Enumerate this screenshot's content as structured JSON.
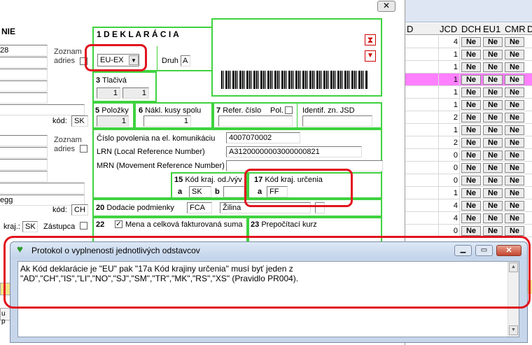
{
  "left_form": {
    "heading": "NIE",
    "sender_value": "28",
    "zoznam_adries_top": "Zoznam adries",
    "zoznam_adries_mid": "Zoznam adries",
    "kod_label_1": "kód:",
    "kod_value_1": "SK",
    "name_value": "egg",
    "kod_label_2": "kód:",
    "kod_value_2": "CH",
    "kraj_label": "kraj.:",
    "kraj_value": "SK",
    "zastupca_label": "Zástupca"
  },
  "declaration": {
    "title": "1  D E K L A R Á C I A",
    "type_value": "EU-EX",
    "druh_label": "Druh",
    "druh_value": "A",
    "tlaciva_num": "3",
    "tlaciva_label": "Tlačivá",
    "tlaciva_value1": "1",
    "tlaciva_value2": "1",
    "polozky_num": "5",
    "polozky_label": "Položky",
    "polozky_value": "1",
    "kusy_num": "6",
    "kusy_label": "Nákl. kusy spolu",
    "kusy_value": "1",
    "refer_num": "7",
    "refer_label": "Refer. číslo",
    "pol_label": "Pol.",
    "identif_label": "Identif. zn. JSD",
    "povolenie_label": "Číslo povolenia na el. komunikáciu",
    "povolenie_value": "4007070002",
    "lrn_label": "LRN (Local Reference Number)",
    "lrn_value": "A31200000003000000821",
    "mrn_label": "MRN (Movement Reference Number)",
    "mrn_value": "",
    "odosl_num": "15",
    "odosl_label": "Kód kraj. od./výv",
    "odosl_a": "a",
    "odosl_value": "SK",
    "odosl_b": "b",
    "urcenia_num": "17",
    "urcenia_label": "Kód kraj. určenia",
    "urcenia_a": "a",
    "urcenia_value": "FF",
    "dodacie_num": "20",
    "dodacie_label": "Dodacie podmienky",
    "dodacie_value": "FCA",
    "dodacie_place": "Žilina",
    "mena_num": "22",
    "mena_label": "Mena a celková fakturovaná suma",
    "kurz_num": "23",
    "kurz_label": "Prepočítací kurz"
  },
  "grid": {
    "headers": [
      "D",
      "JCD",
      "DCH",
      "EU1",
      "CMR",
      "D"
    ],
    "button_label": "Ne",
    "jcd_values": [
      "4",
      "1",
      "1",
      "1",
      "1",
      "1",
      "2",
      "1",
      "2",
      "0",
      "0",
      "0",
      "1",
      "4",
      "4",
      "0"
    ],
    "highlight_color": "#ff80ff"
  },
  "dialog": {
    "title": "Protokol o vyplnenosti jednotlivých odstavcov",
    "message": "Ak Kód deklarácie je \"EU\" pak \"17a Kód krajiny určenia\" musí byť jeden z \"AD\",\"CH\",\"IS\",\"LI\",\"NO\",\"SJ\",\"SM\",\"TR\",\"MK\",\"RS\",\"XS\" (Pravidlo PR004)."
  },
  "bottom_left_fragment": "u p",
  "colors": {
    "accent_green": "#3fd23f",
    "annotation_red": "#e0141e",
    "window_frame": "#c7d6ea"
  }
}
